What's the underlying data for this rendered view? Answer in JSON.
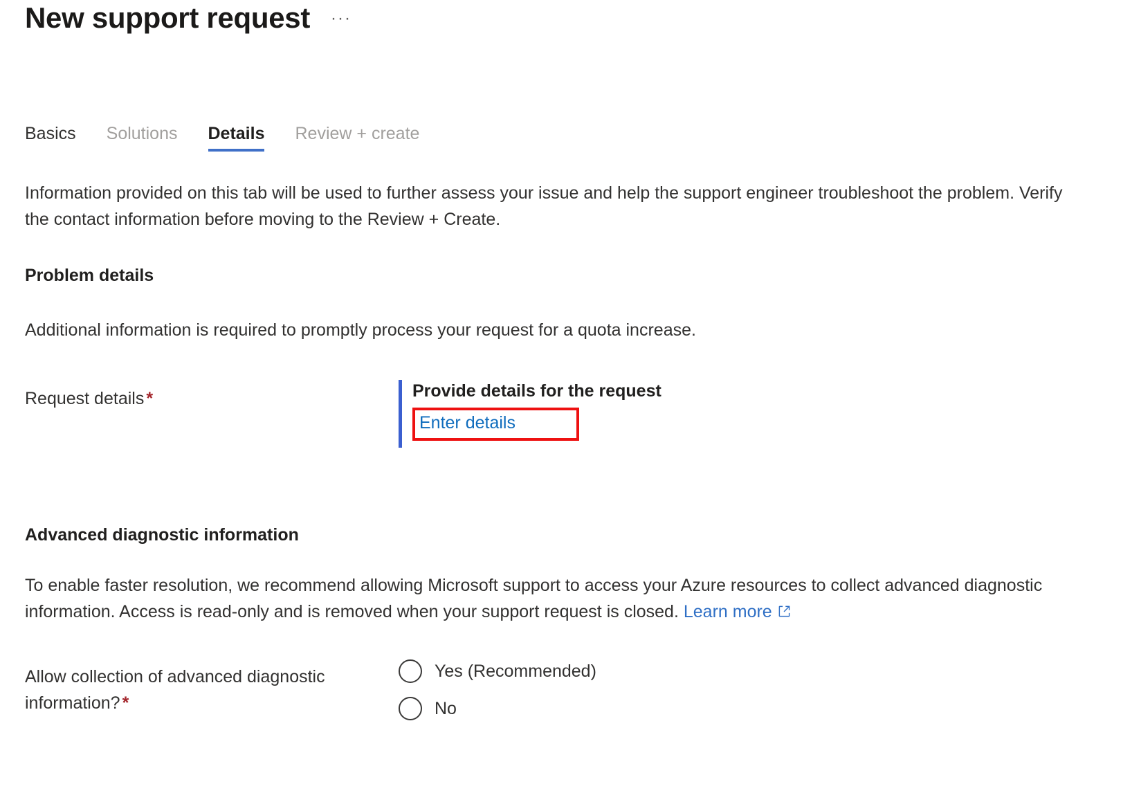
{
  "header": {
    "title": "New support request",
    "more_actions": "···",
    "more_actions_name": "more-actions"
  },
  "tabs": [
    {
      "label": "Basics",
      "state": "enabled"
    },
    {
      "label": "Solutions",
      "state": "disabled"
    },
    {
      "label": "Details",
      "state": "active"
    },
    {
      "label": "Review + create",
      "state": "disabled"
    }
  ],
  "intro": "Information provided on this tab will be used to further assess your issue and help the support engineer troubleshoot the problem. Verify the contact information before moving to the Review + Create.",
  "problem_details": {
    "heading": "Problem details",
    "description": "Additional information is required to promptly process your request for a quota increase.",
    "request_details": {
      "label": "Request details",
      "required_marker": "*",
      "control_heading": "Provide details for the request",
      "link_label": "Enter details"
    }
  },
  "advanced_diagnostics": {
    "heading": "Advanced diagnostic information",
    "description_before_link": "To enable faster resolution, we recommend allowing Microsoft support to access your Azure resources to collect advanced diagnostic information. Access is read-only and is removed when your support request is closed. ",
    "learn_more_label": "Learn more",
    "learn_more_icon": "external-link-icon",
    "allow_collection": {
      "label_line1": "Allow collection of advanced diagnostic",
      "label_line2": "information?",
      "required_marker": "*",
      "options": [
        {
          "label": "Yes (Recommended)",
          "selected": false
        },
        {
          "label": "No",
          "selected": false
        }
      ]
    }
  },
  "colors": {
    "accent_blue": "#0f6cbd",
    "tab_underline": "#4070c8",
    "required_red": "#a4262c",
    "highlight_red": "#ee1111",
    "callout_bar_blue": "#3b5fd0",
    "text_primary": "#201f1e",
    "text_secondary": "#323130",
    "text_disabled": "#a19f9d",
    "background": "#ffffff"
  }
}
